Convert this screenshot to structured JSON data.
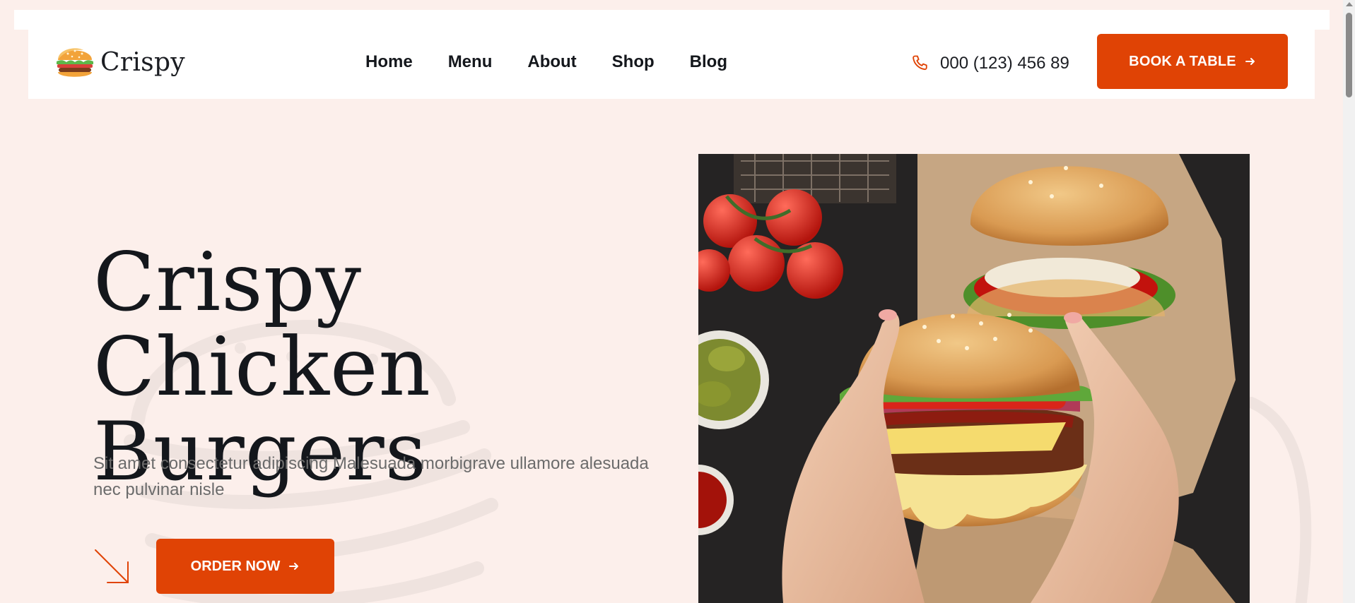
{
  "brand": {
    "name": "Crispy",
    "logo_icon": "burger-logo-icon"
  },
  "nav": {
    "items": [
      {
        "label": "Home"
      },
      {
        "label": "Menu"
      },
      {
        "label": "About"
      },
      {
        "label": "Shop"
      },
      {
        "label": "Blog"
      }
    ]
  },
  "header": {
    "phone_icon": "phone-icon",
    "phone": "000 (123) 456 89",
    "book_label": "BOOK A TABLE"
  },
  "hero": {
    "title_line1": "Crispy Chicken",
    "title_line2": "Burgers",
    "description": "Sit amet consectetur adipiscing Malesuada morbigrave ullamore alesuada nec pulvinar nisle",
    "order_label": "ORDER NOW"
  },
  "colors": {
    "accent": "#e04305",
    "background": "#fcefeb",
    "text": "#14171c",
    "muted_text": "#6b6b6b"
  }
}
